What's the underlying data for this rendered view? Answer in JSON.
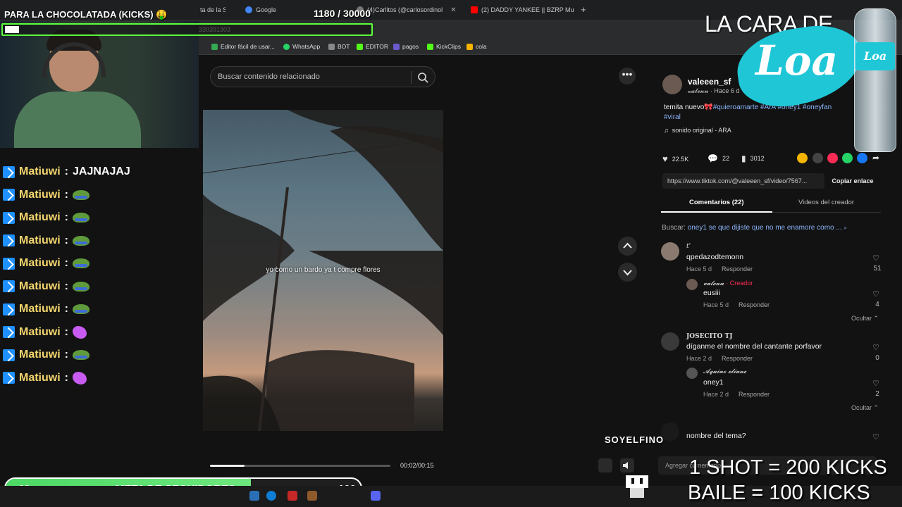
{
  "browser": {
    "tabs": [
      {
        "label": "ta de la S"
      },
      {
        "label": "Google"
      },
      {
        "label": "(4)Carlitos (@carlosordinol"
      },
      {
        "label": "(2) DADDY YANKEE || BZRP Mu"
      }
    ],
    "new_tab": "+",
    "address_fragment": "330391303",
    "bookmarks": [
      "Editor fácil de usar...",
      "WhatsApp",
      "BOT",
      "EDITOR",
      "pagos",
      "KickClips",
      "cola"
    ]
  },
  "tiktok": {
    "search_placeholder": "Buscar contenido relacionado",
    "video_caption": "yo como un bardo ya t compre flores",
    "video_time": "00:02/00:15",
    "progress_fraction": 0.19,
    "author": {
      "username": "valeeen_sf",
      "display": "𝓿𝓪𝓵𝓮𝓷𝓷",
      "posted": "· Hace 6 d"
    },
    "description_text": "temita nuevo🎀",
    "hashtags": [
      "#quieroamarte",
      "#ArA",
      "#oney1",
      "#oneyfan",
      "#viral"
    ],
    "sound": "sonido original - ARA",
    "stats": {
      "likes": "22.5K",
      "comments": "22",
      "saves": "3012"
    },
    "link": "https://www.tiktok.com/@valeeen_sf/video/7567...",
    "copy_label": "Copiar enlace",
    "tab_comments": "Comentarios (22)",
    "tab_videos": "Videos del creador",
    "search_prefix": "Buscar:",
    "search_suggestion": "oney1 se que dijiste que no me enamore como ...",
    "comments": [
      {
        "name": "t'",
        "text": "qpedazodtemonn",
        "meta": "Hace 5 d",
        "reply": "Responder",
        "likes": "51",
        "sub": {
          "name": "𝓿𝓪𝓵𝓮𝓷𝓷",
          "badge": "· Creador",
          "text": "eusiii",
          "meta": "Hace 5 d",
          "reply": "Responder",
          "likes": "4"
        },
        "hide": "Ocultar"
      },
      {
        "name": "JOSECITO TJ",
        "text": "díganme el nombre del cantante porfavor",
        "meta": "Hace 2 d",
        "reply": "Responder",
        "likes": "0",
        "sub": {
          "name": "𝓐𝓺𝓾𝓲𝓷𝓸 𝓮𝓵𝓲𝓪𝓷𝓮",
          "badge": "",
          "text": "oney1",
          "meta": "Hace 2 d",
          "reply": "Responder",
          "likes": "2"
        },
        "hide": "Ocultar"
      },
      {
        "name": "",
        "text": "nombre del tema?",
        "meta": "",
        "reply": "",
        "likes": ""
      }
    ],
    "comment_placeholder": "Agregar comentario..."
  },
  "overlay": {
    "goal_title": "PARA LA CHOCOLATADA (KICKS) 🤑",
    "goal_count": "1180",
    "goal_target": "/ 30000",
    "goal_fraction": 0.039,
    "chat": [
      {
        "user": "Matiuwi",
        "sep": ":",
        "msg": "JAJNAJAJ",
        "emote": ""
      },
      {
        "user": "Matiuwi",
        "sep": ":",
        "msg": "",
        "emote": "frog"
      },
      {
        "user": "Matiuwi",
        "sep": ":",
        "msg": "",
        "emote": "frog"
      },
      {
        "user": "Matiuwi",
        "sep": ":",
        "msg": "",
        "emote": "frog"
      },
      {
        "user": "Matiuwi",
        "sep": ":",
        "msg": "",
        "emote": "frog"
      },
      {
        "user": "Matiuwi",
        "sep": ":",
        "msg": "",
        "emote": "frog"
      },
      {
        "user": "Matiuwi",
        "sep": ":",
        "msg": "",
        "emote": "frog"
      },
      {
        "user": "Matiuwi",
        "sep": ":",
        "msg": "",
        "emote": "butterfly"
      },
      {
        "user": "Matiuwi",
        "sep": ":",
        "msg": "",
        "emote": "frog"
      },
      {
        "user": "Matiuwi",
        "sep": ":",
        "msg": "",
        "emote": "butterfly"
      }
    ],
    "follow_start": "69",
    "follow_label": "META DE SEGUIDORES",
    "follow_end": "100",
    "follow_fraction": 0.69,
    "sponsor": "LA CARA DE",
    "sponsor_logo": "Loa",
    "watermark": "SOYELFINO",
    "kick_line_1": "1 SHOT = 200 KICKS",
    "kick_line_2": "BAILE = 100 KICKS"
  },
  "colors": {
    "accent": "#fe2c55",
    "link": "#8ab4f8",
    "goal_border": "#5cff3c",
    "follow_fill": "#4cd964",
    "kick_badge": "#1e90ff"
  }
}
